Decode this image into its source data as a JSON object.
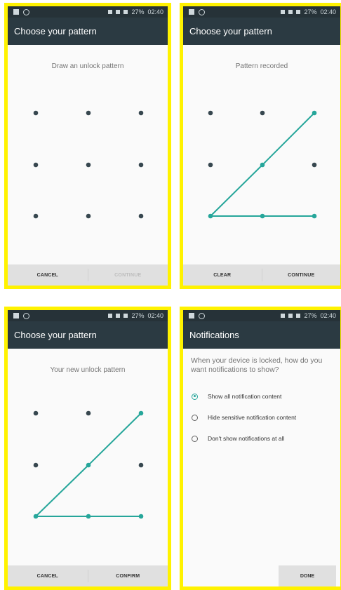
{
  "status_bar": {
    "battery": "27%",
    "time": "02:40"
  },
  "panels": {
    "p1": {
      "title": "Choose your pattern",
      "instruction": "Draw an unlock pattern",
      "left_button": "CANCEL",
      "right_button": "CONTINUE"
    },
    "p2": {
      "title": "Choose your pattern",
      "instruction": "Pattern recorded",
      "left_button": "CLEAR",
      "right_button": "CONTINUE"
    },
    "p3": {
      "title": "Choose your pattern",
      "instruction": "Your new unlock pattern",
      "left_button": "CANCEL",
      "right_button": "CONFIRM"
    },
    "p4": {
      "title": "Notifications",
      "question": "When your device is locked, how do you want notifications to show?",
      "options": [
        "Show all notification content",
        "Hide sensitive notification content",
        "Don't show notifications at all"
      ],
      "selected_option": "Show all notification content",
      "done": "DONE"
    }
  },
  "colors": {
    "accent": "#26a69a",
    "appbar": "#2b3a42",
    "highlight_border": "#fff200"
  }
}
